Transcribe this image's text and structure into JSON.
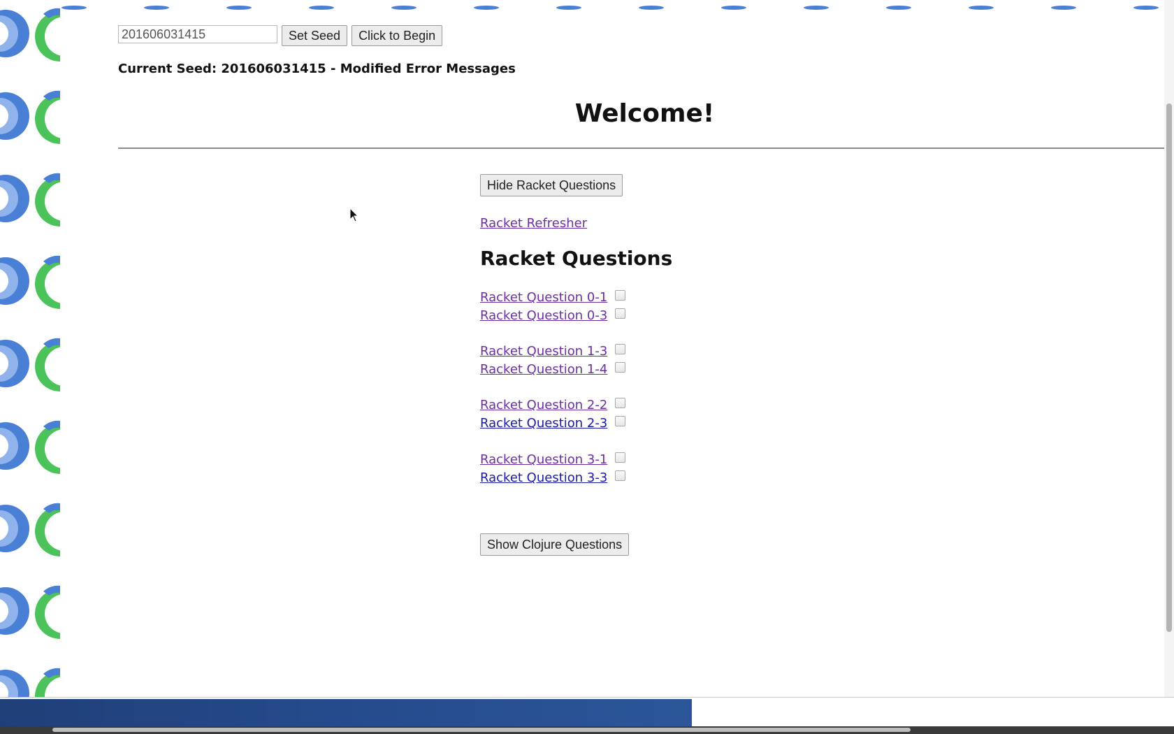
{
  "seed": {
    "input_value": "201606031415",
    "set_seed_label": "Set Seed",
    "begin_label": "Click to Begin"
  },
  "current_seed_text": "Current Seed: 201606031415 - Modified Error Messages",
  "welcome_title": "Welcome!",
  "hide_racket_label": "Hide Racket Questions",
  "refresher_label": "Racket Refresher",
  "racket_heading": "Racket Questions",
  "questions": [
    {
      "label": "Racket Question 0-1",
      "visited": true,
      "checked": false
    },
    {
      "label": "Racket Question 0-3",
      "visited": true,
      "checked": false
    },
    {
      "label": "Racket Question 1-3",
      "visited": true,
      "checked": false
    },
    {
      "label": "Racket Question 1-4",
      "visited": true,
      "checked": false
    },
    {
      "label": "Racket Question 2-2",
      "visited": true,
      "checked": false
    },
    {
      "label": "Racket Question 2-3",
      "visited": false,
      "checked": false
    },
    {
      "label": "Racket Question 3-1",
      "visited": true,
      "checked": false
    },
    {
      "label": "Racket Question 3-3",
      "visited": false,
      "checked": false
    }
  ],
  "show_clojure_label": "Show Clojure Questions",
  "colors": {
    "visited_link": "#6b2fa1",
    "unvisited_link": "#1a1aa8",
    "pattern_blue": "#4a7fd6",
    "pattern_green": "#4cc35a",
    "taskbar_blue": "#254b8c"
  }
}
